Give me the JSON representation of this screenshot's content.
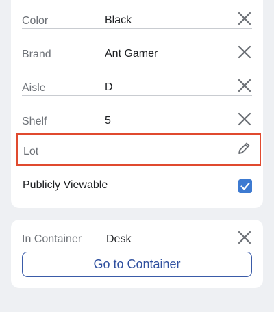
{
  "fields": [
    {
      "label": "Color",
      "value": "Black",
      "action_icon": "close-icon"
    },
    {
      "label": "Brand",
      "value": "Ant Gamer",
      "action_icon": "close-icon"
    },
    {
      "label": "Aisle",
      "value": "D",
      "action_icon": "close-icon"
    },
    {
      "label": "Shelf",
      "value": "5",
      "action_icon": "close-icon"
    }
  ],
  "lot_field": {
    "label": "Lot",
    "value": "",
    "action_icon": "pencil-icon"
  },
  "publicly_viewable": {
    "label": "Publicly Viewable",
    "checked": true
  },
  "container": {
    "label": "In Container",
    "value": "Desk",
    "action_icon": "close-icon",
    "button_label": "Go to Container"
  },
  "colors": {
    "highlight_border": "#e04a2f",
    "accent": "#3d7ad1",
    "button_text": "#2e4f9f"
  }
}
